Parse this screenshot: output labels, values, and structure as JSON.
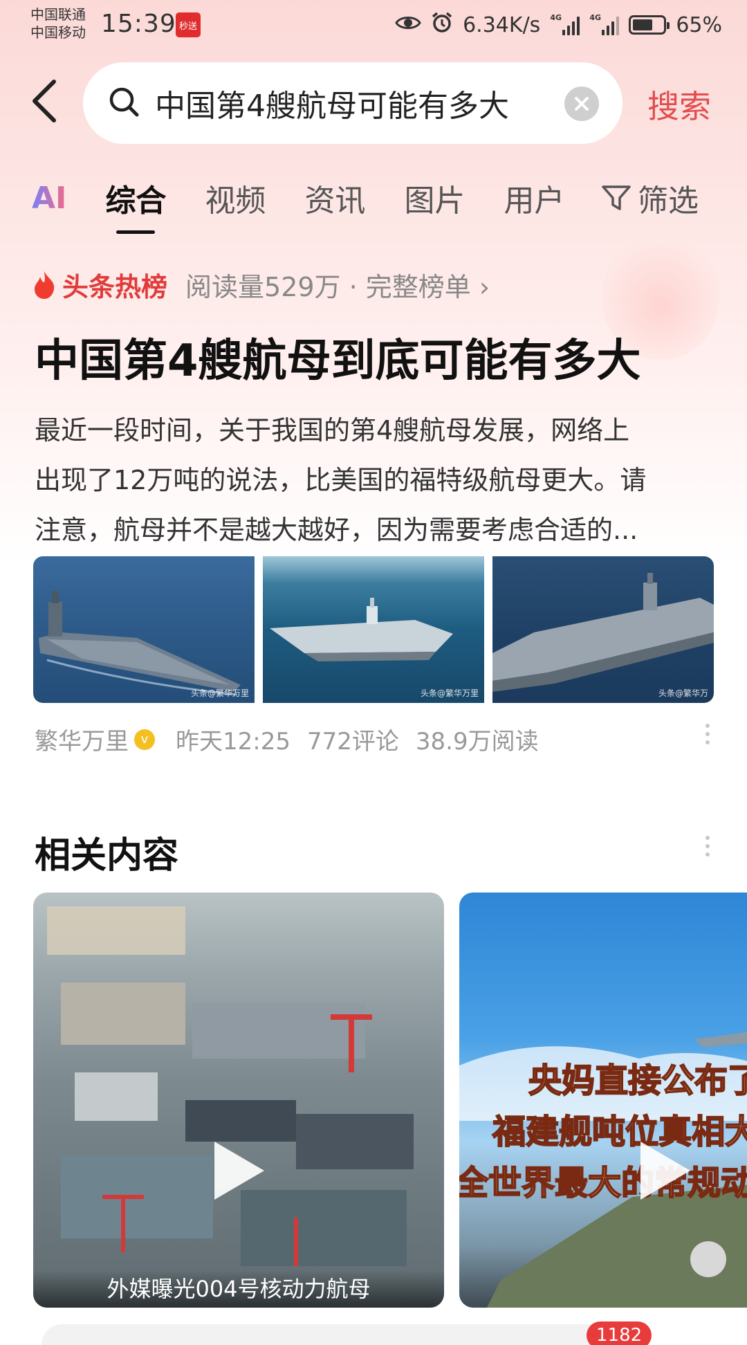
{
  "status_bar": {
    "carrier_1": "中国联通",
    "carrier_2": "中国移动",
    "time": "15:39",
    "app_badge": "秒送",
    "net_speed": "6.34K/s",
    "signal_1_tag": "4G",
    "signal_2_tag": "4G",
    "battery_pct": "65%",
    "battery_level": 0.65
  },
  "search": {
    "query": "中国第4艘航母可能有多大",
    "button_label": "搜索"
  },
  "tabs": {
    "ai": "AI",
    "items": [
      "综合",
      "视频",
      "资讯",
      "图片",
      "用户"
    ],
    "active_index": 0,
    "filter_label": "筛选"
  },
  "hot": {
    "title": "头条热榜",
    "meta": "阅读量529万 · 完整榜单 ›"
  },
  "article": {
    "headline": "中国第4艘航母到底可能有多大",
    "summary_lines": [
      "最近一段时间，关于我国的第4艘航母发展，网络上",
      "出现了12万吨的说法，比美国的福特级航母更大。请",
      "注意，航母并不是越大越好，因为需要考虑合适的..."
    ],
    "image_watermarks": [
      "头条@繁华万里",
      "头条@繁华万里",
      "头条@繁华万"
    ],
    "author": "繁华万里",
    "verified_mark": "v",
    "time": "昨天12:25",
    "comments": "772评论",
    "reads": "38.9万阅读"
  },
  "related": {
    "title": "相关内容",
    "video_1_caption": "外媒曝光004号核动力航母",
    "video_2_overlay": [
      "央妈直接公布了",
      "福建舰吨位真相大",
      "全世界最大的常规动"
    ]
  },
  "bottom": {
    "badge_count": "1182"
  },
  "colors": {
    "accent": "#e24d4d",
    "hot_red": "#e23b3b",
    "header_bg": "#fbd9d7"
  }
}
